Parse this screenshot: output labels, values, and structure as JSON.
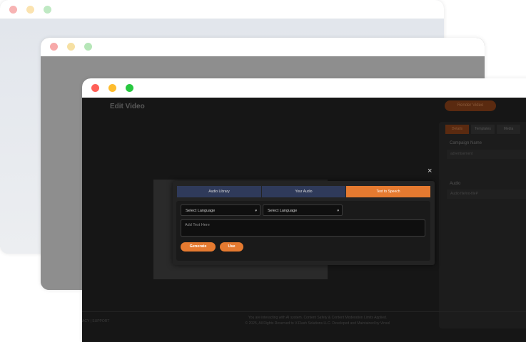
{
  "windows": {
    "back": {
      "dots": [
        "#f7b3b3",
        "#fbe3b0",
        "#bfe9c3"
      ]
    },
    "middle": {
      "dots": [
        "#f7a9a9",
        "#f6e0a3",
        "#b6e6b8"
      ]
    },
    "front": {
      "dots": [
        "#ff5f57",
        "#febc2e",
        "#28c840"
      ]
    }
  },
  "app": {
    "title": "Edit Video",
    "render_button": "Render Video"
  },
  "right_panel": {
    "tabs": [
      "Details",
      "Templates",
      "Media"
    ],
    "campaign_label": "Campaign Name",
    "campaign_value": "advertisement",
    "audio_label": "Audio",
    "audio_value": "Audio file/no-fileP"
  },
  "modal": {
    "tabs": [
      {
        "label": "Audio Library",
        "color": "#2f3a5a"
      },
      {
        "label": "Your Audio",
        "color": "#2f3a5a"
      },
      {
        "label": "Text to Speech",
        "color": "#e57a30"
      }
    ],
    "select1": "Select Language",
    "select2": "Select Language",
    "textarea_placeholder": "Add Text Here",
    "generate_button": "Generate",
    "use_button": "Use",
    "close_icon": "×"
  },
  "footer": {
    "left": "ACY | SUPPORT",
    "line1": "You are interacting with AI system. Content Safety & Content Moderation Limits Applied.",
    "line2": "© 2025, All Rights Reserved to V-Flash Solutions LLC. Developed and Maintained by Vinsol"
  },
  "accent": "#e57a30"
}
